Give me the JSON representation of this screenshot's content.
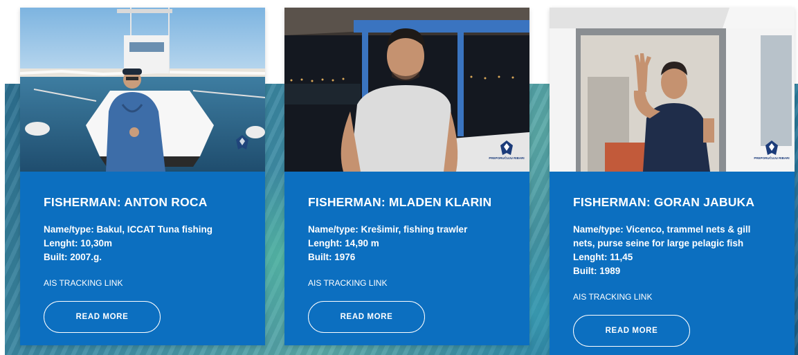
{
  "cards": [
    {
      "title": "FISHERMAN: ANTON ROCA",
      "info_lines": [
        "Name/type: Bakul, ICCAT Tuna fishing",
        "Lenght: 10,30m",
        "Built: 2007.g."
      ],
      "ais_link": "AIS TRACKING LINK",
      "read_more": "READ MORE",
      "photo_icon": "fisherman-photo-icon"
    },
    {
      "title": "FISHERMAN: MLADEN KLARIN",
      "info_lines": [
        "Name/type: Krešimir, fishing trawler",
        "Lenght: 14,90 m",
        "Built: 1976"
      ],
      "ais_link": "AIS TRACKING LINK",
      "read_more": "READ MORE",
      "photo_icon": "fisherman-photo-icon",
      "logo_text": "PREPORUČUJU RIBARI"
    },
    {
      "title": "FISHERMAN: GORAN JABUKA",
      "info_lines": [
        "Name/type: Vicenco, trammel nets & gill",
        "nets, purse seine for large pelagic fish",
        "Lenght: 11,45",
        "Built: 1989"
      ],
      "ais_link": "AIS TRACKING LINK",
      "read_more": "READ MORE",
      "photo_icon": "fisherman-photo-icon",
      "logo_text": "PREPORUČUJU RIBARI"
    }
  ],
  "colors": {
    "card_blue": "#0c6fc0",
    "text": "#ffffff",
    "logo": "#1c3c7a"
  }
}
